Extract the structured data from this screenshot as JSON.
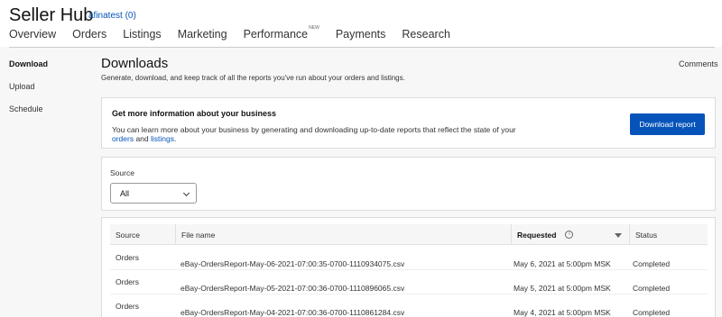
{
  "header": {
    "app_title": "Seller Hub",
    "user": "afinatest (0)"
  },
  "nav": {
    "items": [
      {
        "label": "Overview"
      },
      {
        "label": "Orders"
      },
      {
        "label": "Listings"
      },
      {
        "label": "Marketing"
      },
      {
        "label": "Performance",
        "badge": "NEW"
      },
      {
        "label": "Payments"
      },
      {
        "label": "Research"
      }
    ]
  },
  "sidebar": {
    "items": [
      {
        "label": "Download",
        "active": true
      },
      {
        "label": "Upload"
      },
      {
        "label": "Schedule"
      }
    ]
  },
  "page": {
    "title": "Downloads",
    "description": "Generate, download, and keep track of all the reports you've run about your orders and listings.",
    "comments_label": "Comments"
  },
  "info_card": {
    "title": "Get more information about your business",
    "text_before": "You can learn more about your business by generating and downloading up-to-date reports that reflect the state of your ",
    "link_orders": "orders",
    "text_and": " and ",
    "link_listings": "listings",
    "text_end": ".",
    "button_label": "Download report"
  },
  "filter": {
    "label": "Source",
    "selected": "All"
  },
  "table": {
    "columns": {
      "source": "Source",
      "file_name": "File name",
      "requested": "Requested",
      "status": "Status"
    },
    "rows": [
      {
        "source": "Orders",
        "file_name": "eBay-OrdersReport-May-06-2021-07:00:35-0700-1110934075.csv",
        "requested": "May 6, 2021 at 5:00pm MSK",
        "status": "Completed"
      },
      {
        "source": "Orders",
        "file_name": "eBay-OrdersReport-May-05-2021-07:00:36-0700-1110896065.csv",
        "requested": "May 5, 2021 at 5:00pm MSK",
        "status": "Completed"
      },
      {
        "source": "Orders",
        "file_name": "eBay-OrdersReport-May-04-2021-07:00:36-0700-1110861284.csv",
        "requested": "May 4, 2021 at 5:00pm MSK",
        "status": "Completed"
      }
    ]
  },
  "colors": {
    "primary_button": "#0654ba",
    "link": "#0654ba"
  }
}
